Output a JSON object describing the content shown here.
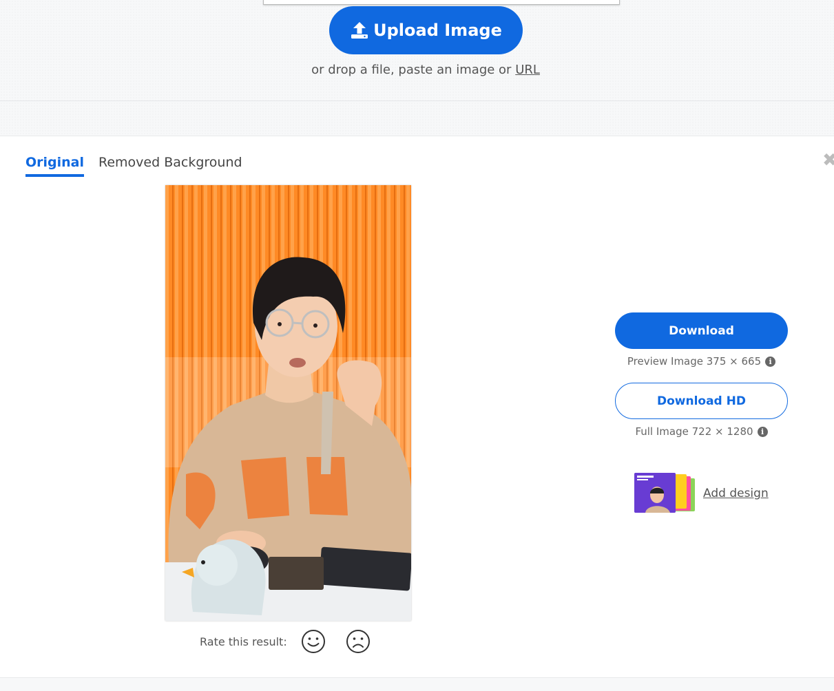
{
  "upload": {
    "button_label": "Upload Image",
    "hint_prefix": "or drop a file, paste an image or",
    "hint_link": "URL"
  },
  "result": {
    "tabs": [
      {
        "label": "Original",
        "active": true
      },
      {
        "label": "Removed Background",
        "active": false
      }
    ],
    "close_icon": "✖",
    "rate_label": "Rate this result:"
  },
  "downloads": {
    "download_label": "Download",
    "preview_info": "Preview Image 375 × 665",
    "download_hd_label": "Download HD",
    "full_info": "Full Image 722 × 1280",
    "info_glyph": "i"
  },
  "add_design": {
    "link_label": "Add design"
  },
  "colors": {
    "accent": "#1069e0",
    "orange_backdrop": "#ff8c2a"
  },
  "icons": [
    "upload-icon",
    "close-icon",
    "info-icon",
    "smile-face-icon",
    "sad-face-icon"
  ]
}
